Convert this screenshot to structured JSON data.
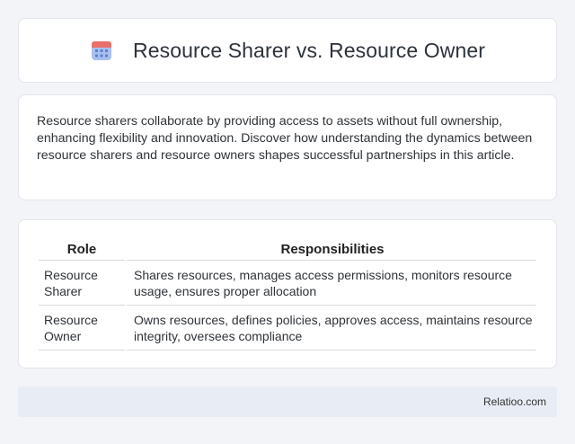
{
  "header": {
    "title": "Resource Sharer vs. Resource Owner",
    "icon": "calendar-icon",
    "colors": {
      "icon_top": "#e8706a",
      "icon_body": "#6a8fd8",
      "icon_dots": "#4f74c8"
    }
  },
  "intro": {
    "text": "Resource sharers collaborate by providing access to assets without full ownership, enhancing flexibility and innovation. Discover how understanding the dynamics between resource sharers and resource owners shapes successful partnerships in this article."
  },
  "table": {
    "headers": [
      "Role",
      "Responsibilities"
    ],
    "rows": [
      {
        "role": "Resource Sharer",
        "responsibilities": "Shares resources, manages access permissions, monitors resource usage, ensures proper allocation"
      },
      {
        "role": "Resource Owner",
        "responsibilities": "Owns resources, defines policies, approves access, maintains resource integrity, oversees compliance"
      }
    ]
  },
  "footer": {
    "text": "Relatioo.com"
  }
}
